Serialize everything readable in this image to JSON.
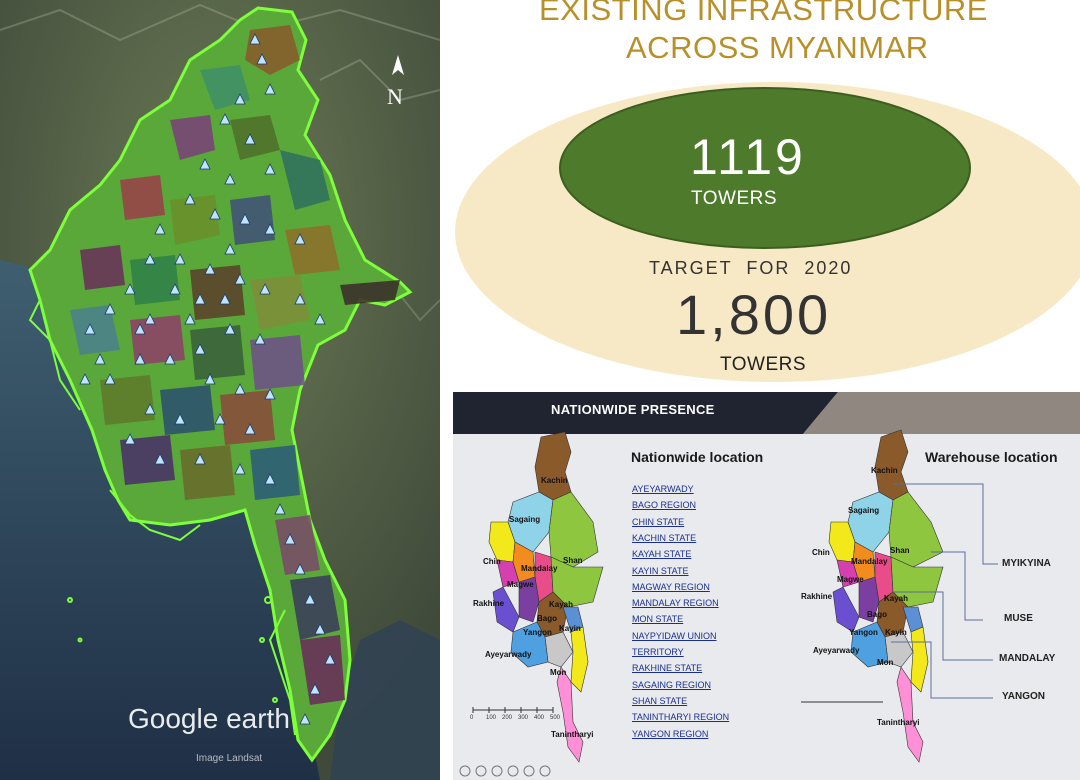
{
  "satellite_map": {
    "compass_letter": "N",
    "watermark": "Google earth",
    "imagery_credit": "Image Landsat"
  },
  "infrastructure": {
    "title_line1": "EXISTING INFRASTRUCTURE",
    "title_line2": "ACROSS MYANMAR",
    "existing_count": "1119",
    "existing_unit": "TOWERS",
    "target_label": "TARGET  FOR  2020",
    "target_count": "1,800",
    "target_unit": "TOWERS",
    "colors": {
      "title": "#b8902a",
      "inner_ellipse": "#4e7a2b",
      "outer_ellipse": "#f8e9c6"
    }
  },
  "presence": {
    "banner_title": "NATIONWIDE PRESENCE",
    "nationwide_heading": "Nationwide location",
    "warehouse_heading": "Warehouse location",
    "regions": [
      "AYEYARWADY",
      "BAGO REGION",
      "CHIN STATE",
      "KACHIN STATE",
      "KAYAH STATE",
      "KAYIN STATE",
      "MAGWAY REGION",
      "MANDALAY REGION",
      "MON STATE",
      "NAYPYIDAW UNION",
      "TERRITORY",
      "RAKHINE STATE",
      "SAGAING REGION",
      "SHAN STATE",
      "TANINTHARYI REGION",
      "YANGON REGION"
    ],
    "warehouses": [
      "MYIKYINA",
      "MUSE",
      "MANDALAY",
      "YANGON"
    ],
    "map_labels": {
      "kachin": "Kachin",
      "sagaing": "Sagaing",
      "chin": "Chin",
      "shan": "Shan",
      "mandalay": "Mandalay",
      "magwe": "Magwe",
      "rakhine": "Rakhine",
      "kayah": "Kayah",
      "bago": "Bago",
      "yangon": "Yangon",
      "kayin": "Kayin",
      "ayeyarwady": "Ayeyarwady",
      "mon": "Mon",
      "tanintharyi": "Tanintharyi"
    },
    "scale_ticks": [
      "0",
      "100",
      "200",
      "300",
      "400",
      "500"
    ]
  }
}
